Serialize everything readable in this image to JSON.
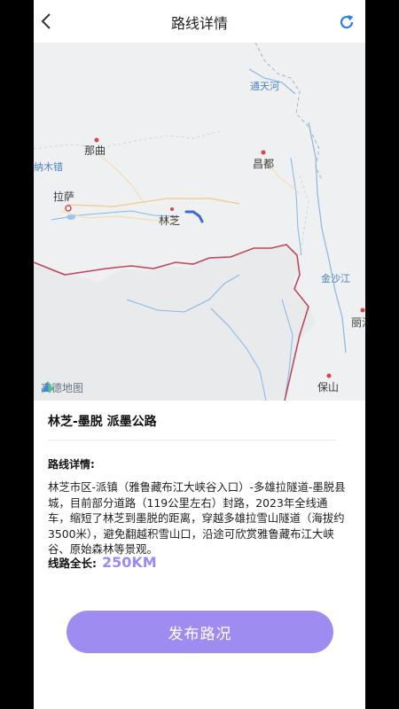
{
  "header": {
    "title": "路线详情",
    "back_icon": "chevron-left-icon",
    "refresh_icon": "refresh-icon",
    "refresh_color": "#2b7be8"
  },
  "map": {
    "places": [
      "那曲",
      "昌都",
      "拉萨",
      "林芝",
      "金沙江",
      "丽江",
      "保山",
      "纳木错"
    ],
    "rivers": [
      "通天河",
      "金沙江"
    ],
    "attribution": "高德地图",
    "route_color": "#3d6bd6"
  },
  "route": {
    "name": "林芝-墨脱 派墨公路",
    "detail_label": "路线详情:",
    "detail_text": "林芝市区-派镇（雅鲁藏布江大峡谷入口）-多雄拉隧道-墨脱县城，目前部分道路（119公里左右）封路，2023年全线通车，缩短了林芝到墨脱的距离，穿越多雄拉雪山隧道（海拔约3500米），避免翻越积雪山口，沿途可欣赏雅鲁藏布江大峡谷、原始森林等景观。",
    "length_label": "线路全长:",
    "length_value": "250KM"
  },
  "actions": {
    "publish_label": "发布路况"
  },
  "colors": {
    "accent": "#9f8cf0",
    "border": "#c0475a"
  }
}
